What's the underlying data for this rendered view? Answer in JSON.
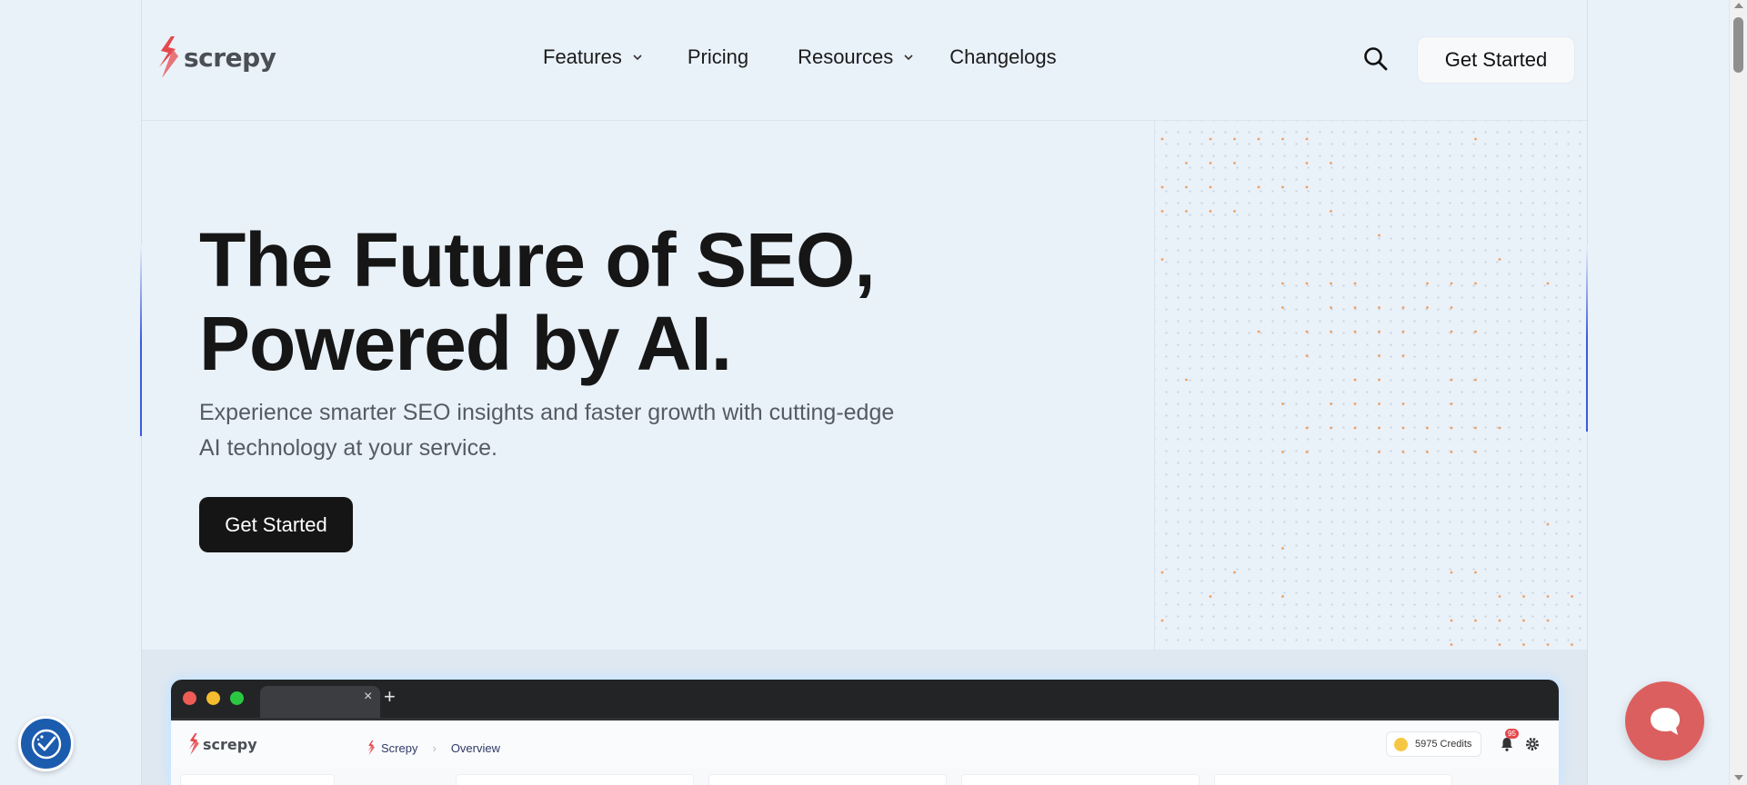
{
  "brand": {
    "name": "screpy",
    "accent": "#e5484d"
  },
  "nav": {
    "items": [
      {
        "label": "Features",
        "has_dropdown": true
      },
      {
        "label": "Pricing",
        "has_dropdown": false
      },
      {
        "label": "Resources",
        "has_dropdown": true
      },
      {
        "label": "Changelogs",
        "has_dropdown": false
      }
    ],
    "search_icon": "search-icon",
    "cta_label": "Get Started"
  },
  "hero": {
    "title_line1": "The Future of SEO,",
    "title_line2": "Powered by AI.",
    "subtitle": "Experience smarter SEO insights and faster growth with cutting-edge AI technology at your service.",
    "cta_label": "Get Started"
  },
  "preview": {
    "tab_close": "×",
    "tab_add": "+",
    "app_brand": "screpy",
    "breadcrumb": [
      "Screpy",
      "Overview"
    ],
    "credits": "5975 Credits",
    "notification_count": "95"
  },
  "colors": {
    "background": "#e9f1f9",
    "primary_button": "#151515",
    "chat_button": "#dc5f5f",
    "accessibility_button": "#1c5cae",
    "dot_accent": "#f0a060"
  }
}
